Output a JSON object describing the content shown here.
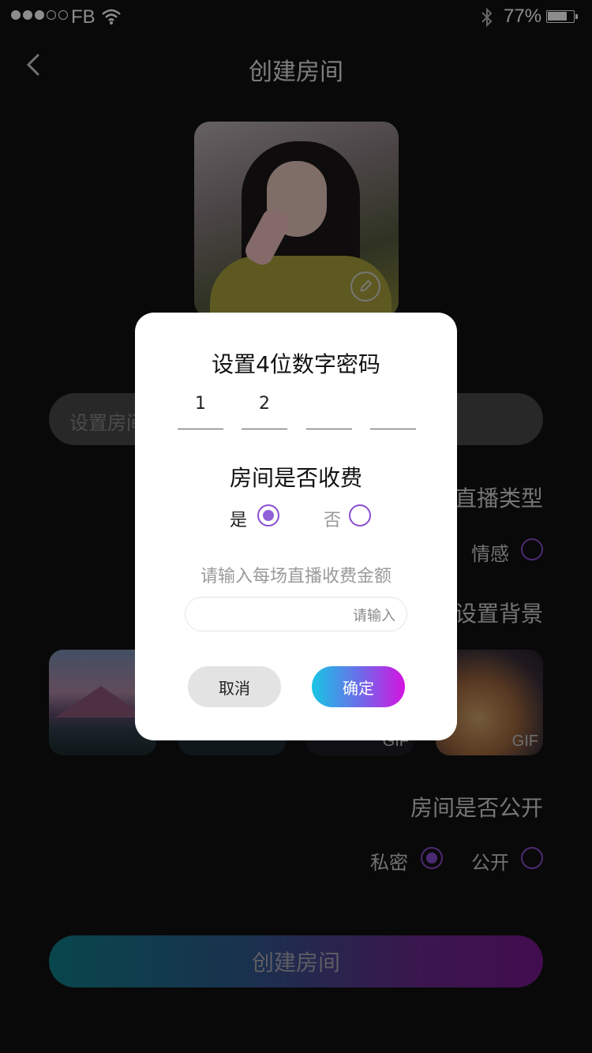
{
  "status_bar": {
    "carrier": "FB",
    "battery_percent": "77%",
    "battery_level": 0.77,
    "signal_bars_filled": 3,
    "signal_bars_total": 5
  },
  "nav": {
    "back_icon": "chevron-left-icon",
    "title": "创建房间"
  },
  "cover": {
    "edit_icon": "pencil-icon"
  },
  "form": {
    "room_name_placeholder": "设置房间",
    "live_type": {
      "label": "直播类型",
      "options": [
        {
          "label": "情感",
          "selected": false
        }
      ]
    },
    "background": {
      "label": "设置背景",
      "gif_tag": "GIF"
    },
    "visibility": {
      "label": "房间是否公开",
      "options": [
        {
          "label": "私密",
          "selected": true
        },
        {
          "label": "公开",
          "selected": false
        }
      ]
    },
    "create_button": "创建房间"
  },
  "modal": {
    "password_title": "设置4位数字密码",
    "digits": [
      "1",
      "2",
      "",
      ""
    ],
    "fee_title": "房间是否收费",
    "fee_options": [
      {
        "label": "是",
        "selected": true
      },
      {
        "label": "否",
        "selected": false
      }
    ],
    "fee_hint": "请输入每场直播收费金额",
    "fee_input_placeholder": "请输入",
    "cancel": "取消",
    "confirm": "确定"
  },
  "colors": {
    "accent_purple": "#8a4ed0",
    "background": "#121212",
    "confirm_gradient_start": "#18c6e4",
    "confirm_gradient_end": "#d414e0"
  }
}
